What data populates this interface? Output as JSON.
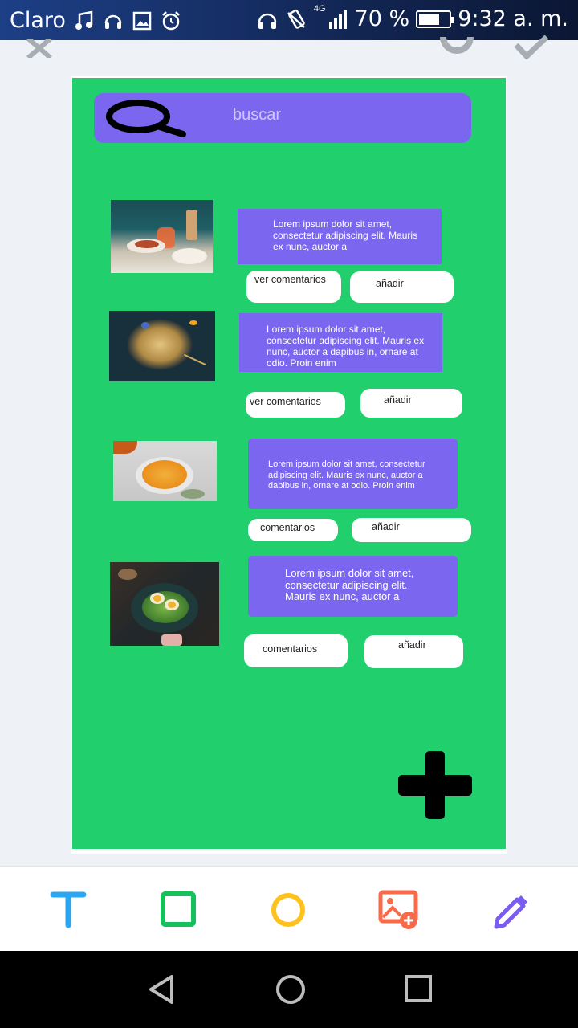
{
  "status_bar": {
    "carrier": "Claro",
    "battery_percent": "70 %",
    "battery_level": 0.7,
    "network": "4G",
    "time": "9:32 a. m."
  },
  "search": {
    "placeholder": "buscar"
  },
  "items": [
    {
      "description": "Lorem ipsum dolor sit amet, consectetur adipiscing elit. Mauris ex nunc, auctor a",
      "comments_label": "ver comentarios",
      "add_label": "añadir"
    },
    {
      "description": "Lorem ipsum dolor sit amet, consectetur adipiscing elit. Mauris ex nunc, auctor a dapibus in, ornare at odio. Proin enim",
      "comments_label": "ver comentarios",
      "add_label": "añadir"
    },
    {
      "description": "Lorem ipsum dolor sit amet, consectetur adipiscing elit. Mauris ex nunc, auctor a dapibus in, ornare at odio. Proin enim",
      "comments_label": "comentarios",
      "add_label": "añadir"
    },
    {
      "description": "Lorem ipsum dolor sit amet, consectetur adipiscing elit. Mauris ex nunc, auctor a",
      "comments_label": "comentarios",
      "add_label": "añadir"
    }
  ],
  "colors": {
    "canvas": "#22cf6d",
    "accent": "#7b66f0",
    "text_tool": "#2aa6f2",
    "rect_tool": "#16c15b",
    "circle_tool": "#ffc21c",
    "image_tool": "#f76b4a",
    "pen_tool": "#7b5cf0"
  },
  "icons": [
    "close-icon",
    "undo-icon",
    "check-icon",
    "search-icon",
    "plus-icon",
    "text-tool-icon",
    "rectangle-tool-icon",
    "circle-tool-icon",
    "add-image-tool-icon",
    "pencil-tool-icon",
    "back-icon",
    "home-icon",
    "recents-icon"
  ]
}
